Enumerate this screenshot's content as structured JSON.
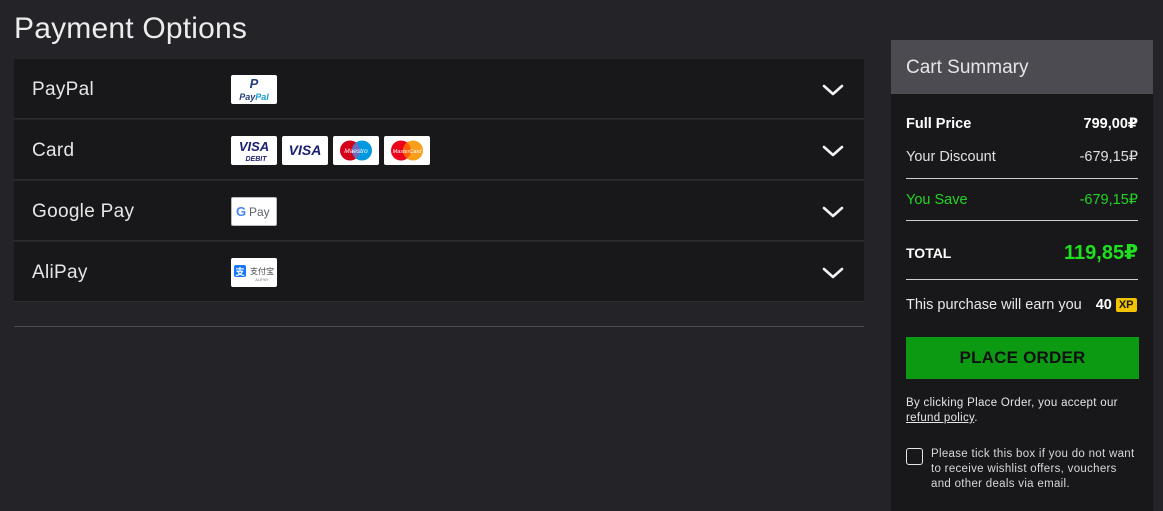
{
  "title": "Payment Options",
  "payment_methods": [
    {
      "label": "PayPal",
      "logos": [
        "PayPal"
      ]
    },
    {
      "label": "Card",
      "logos": [
        "VISA DEBIT",
        "VISA",
        "Maestro",
        "MasterCard"
      ]
    },
    {
      "label": "Google Pay",
      "logos": [
        "G Pay"
      ]
    },
    {
      "label": "AliPay",
      "logos": [
        "支付宝 ALIPAY"
      ]
    }
  ],
  "cart": {
    "header": "Cart Summary",
    "full_price_label": "Full Price",
    "full_price": "799,00₽",
    "discount_label": "Your Discount",
    "discount": "-679,15₽",
    "save_label": "You Save",
    "save": "-679,15₽",
    "total_label": "TOTAL",
    "total": "119,85₽",
    "earn_text": "This purchase will earn you",
    "xp_value": "40",
    "xp_badge": "XP",
    "place_order": "PLACE ORDER",
    "terms_prefix": "By clicking Place Order, you accept our",
    "terms_link": "refund policy",
    "terms_suffix": ".",
    "optout_text": "Please tick this box if you do not want to receive wishlist offers, vouchers and other deals via email."
  },
  "colors": {
    "accent_green": "#0c9a12",
    "save_green": "#23d323",
    "total_green": "#1fe01f",
    "xp_yellow": "#f2c300"
  }
}
